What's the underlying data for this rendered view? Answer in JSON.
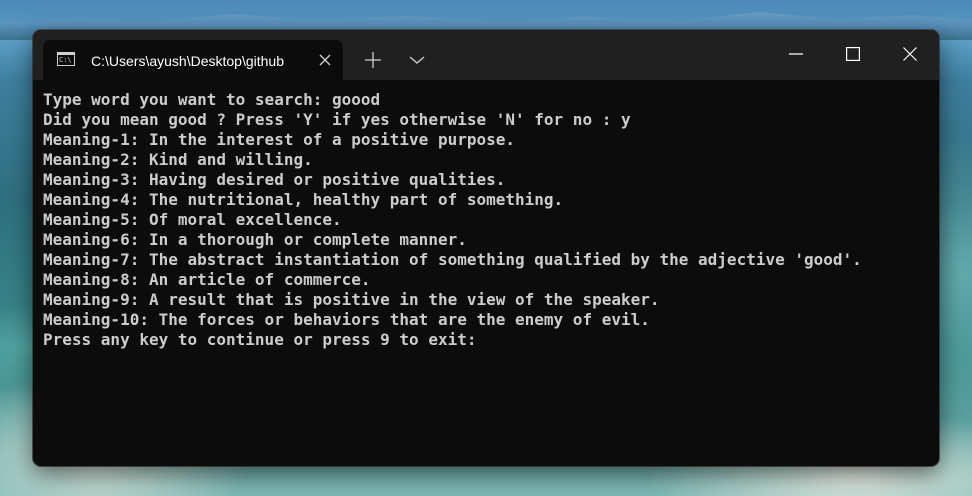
{
  "window": {
    "tab_title": "C:\\Users\\ayush\\Desktop\\github",
    "tab_icon_glyph": "C:\\",
    "icons": {
      "tab": "terminal-icon",
      "close_tab": "close-icon",
      "new_tab": "plus-icon",
      "dropdown": "chevron-down-icon",
      "minimize": "minimize-icon",
      "maximize": "maximize-icon",
      "close_window": "close-icon"
    }
  },
  "terminal": {
    "lines": [
      "Type word you want to search: goood",
      "Did you mean good ? Press 'Y' if yes otherwise 'N' for no : y",
      "Meaning-1: In the interest of a positive purpose.",
      "Meaning-2: Kind and willing.",
      "Meaning-3: Having desired or positive qualities.",
      "Meaning-4: The nutritional, healthy part of something.",
      "Meaning-5: Of moral excellence.",
      "Meaning-6: In a thorough or complete manner.",
      "Meaning-7: The abstract instantiation of something qualified by the adjective 'good'.",
      "Meaning-8: An article of commerce.",
      "Meaning-9: A result that is positive in the view of the speaker.",
      "Meaning-10: The forces or behaviors that are the enemy of evil.",
      "Press any key to continue or press 9 to exit:"
    ]
  },
  "colors": {
    "terminal_bg": "#0c0c0c",
    "titlebar_bg": "#202020",
    "terminal_text": "#cccccc"
  }
}
